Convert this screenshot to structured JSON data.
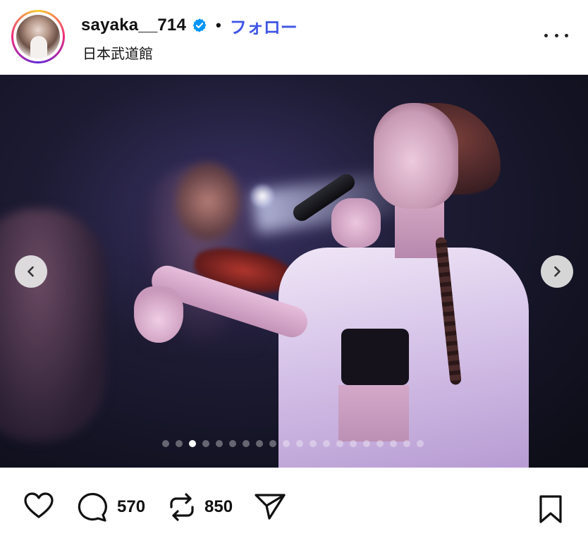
{
  "post": {
    "username": "sayaka__714",
    "separator": "•",
    "follow_label": "フォロー",
    "location": "日本武道館",
    "verified": true,
    "accent_color": "#3f55e8"
  },
  "carousel": {
    "total_slides": 20,
    "active_index": 2
  },
  "actions": {
    "like_icon": "heart-icon",
    "comment_icon": "speech-bubble-icon",
    "comment_count": "570",
    "repost_icon": "repost-icon",
    "repost_count": "850",
    "share_icon": "paper-plane-icon",
    "bookmark_icon": "bookmark-icon"
  }
}
